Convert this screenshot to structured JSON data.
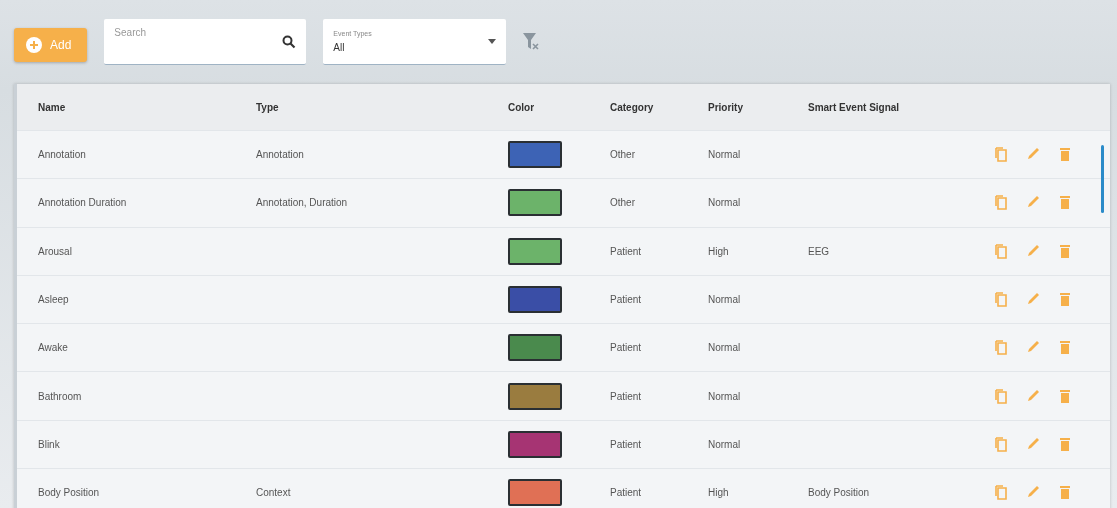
{
  "toolbar": {
    "add_button": "Add",
    "search": {
      "placeholder": "Search"
    },
    "event_types": {
      "label": "Event Types",
      "value": "All"
    }
  },
  "table": {
    "columns": [
      "Name",
      "Type",
      "Color",
      "Category",
      "Priority",
      "Smart Event Signal"
    ],
    "rows": [
      {
        "name": "Annotation",
        "type": "Annotation",
        "color": "#3d63b5",
        "category": "Other",
        "priority": "Normal",
        "signal": ""
      },
      {
        "name": "Annotation Duration",
        "type": "Annotation, Duration",
        "color": "#6cb36a",
        "category": "Other",
        "priority": "Normal",
        "signal": ""
      },
      {
        "name": "Arousal",
        "type": "",
        "color": "#6cb36a",
        "category": "Patient",
        "priority": "High",
        "signal": "EEG"
      },
      {
        "name": "Asleep",
        "type": "",
        "color": "#3a4ea6",
        "category": "Patient",
        "priority": "Normal",
        "signal": ""
      },
      {
        "name": "Awake",
        "type": "",
        "color": "#4a8a4d",
        "category": "Patient",
        "priority": "Normal",
        "signal": ""
      },
      {
        "name": "Bathroom",
        "type": "",
        "color": "#9a7c3f",
        "category": "Patient",
        "priority": "Normal",
        "signal": ""
      },
      {
        "name": "Blink",
        "type": "",
        "color": "#a63473",
        "category": "Patient",
        "priority": "Normal",
        "signal": ""
      },
      {
        "name": "Body Position",
        "type": "Context",
        "color": "#e07055",
        "category": "Patient",
        "priority": "High",
        "signal": "Body Position"
      }
    ]
  }
}
